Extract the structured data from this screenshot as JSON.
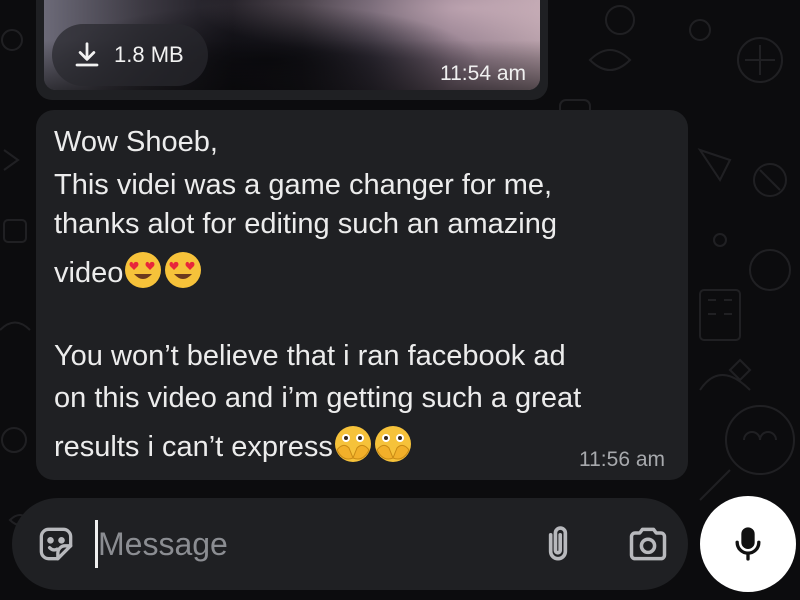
{
  "media_message": {
    "file_size": "1.8 MB",
    "time": "11:54 am",
    "download_icon": "download-icon"
  },
  "text_message": {
    "lines": [
      "Wow Shoeb,",
      "This videi was a game changer for me,",
      "thanks alot for editing such an amazing",
      "video",
      "",
      "You won’t believe that i ran facebook ad",
      "on this video and i’m getting such a great",
      "results i can’t express"
    ],
    "emoji_line4": "smiling-face-with-heart-eyes",
    "emoji_line8": "face-with-open-eyes-and-hand-over-mouth",
    "time": "11:56 am"
  },
  "composer": {
    "placeholder": "Message",
    "value": "",
    "sticker_icon": "sticker-icon",
    "attach_icon": "paperclip-icon",
    "camera_icon": "camera-icon",
    "mic_icon": "microphone-icon"
  },
  "colors": {
    "background": "#0c0c0e",
    "bubble": "#1f2023",
    "text": "#ececec",
    "timestamp": "#a7a9ad",
    "mic_button": "#ffffff"
  }
}
